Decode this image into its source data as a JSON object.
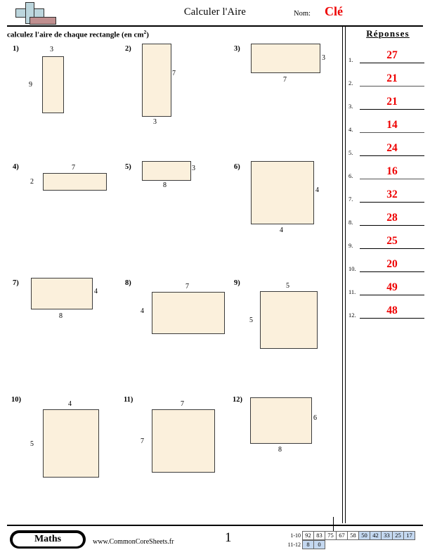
{
  "header": {
    "title": "Calculer l'Aire",
    "name_label": "Nom:",
    "name_value": "Clé",
    "instructions_prefix": "calculez l'aire de chaque rectangle (en cm",
    "instructions_sup": "2",
    "instructions_suffix": ")",
    "logo_icon": "plus-sign-logo",
    "answer_color": "#ee0000"
  },
  "answers": {
    "heading": "Réponses",
    "items": [
      {
        "num": "1.",
        "value": "27"
      },
      {
        "num": "2.",
        "value": "21"
      },
      {
        "num": "3.",
        "value": "21"
      },
      {
        "num": "4.",
        "value": "14"
      },
      {
        "num": "5.",
        "value": "24"
      },
      {
        "num": "6.",
        "value": "16"
      },
      {
        "num": "7.",
        "value": "32"
      },
      {
        "num": "8.",
        "value": "28"
      },
      {
        "num": "9.",
        "value": "25"
      },
      {
        "num": "10.",
        "value": "20"
      },
      {
        "num": "11.",
        "value": "49"
      },
      {
        "num": "12.",
        "value": "48"
      }
    ]
  },
  "problems": [
    {
      "label": "1)",
      "top": "3",
      "left": "9",
      "bottom": "",
      "right": "",
      "area": "27"
    },
    {
      "label": "2)",
      "top": "",
      "left": "",
      "bottom": "3",
      "right": "7",
      "area": "21"
    },
    {
      "label": "3)",
      "top": "",
      "left": "",
      "bottom": "7",
      "right": "3",
      "area": "21"
    },
    {
      "label": "4)",
      "top": "7",
      "left": "2",
      "bottom": "",
      "right": "",
      "area": "14"
    },
    {
      "label": "5)",
      "top": "",
      "left": "",
      "bottom": "8",
      "right": "3",
      "area": "24"
    },
    {
      "label": "6)",
      "top": "",
      "left": "",
      "bottom": "4",
      "right": "4",
      "area": "16"
    },
    {
      "label": "7)",
      "top": "",
      "left": "",
      "bottom": "8",
      "right": "4",
      "area": "32"
    },
    {
      "label": "8)",
      "top": "7",
      "left": "4",
      "bottom": "",
      "right": "",
      "area": "28"
    },
    {
      "label": "9)",
      "top": "5",
      "left": "5",
      "bottom": "",
      "right": "",
      "area": "25"
    },
    {
      "label": "10)",
      "top": "4",
      "left": "5",
      "bottom": "",
      "right": "",
      "area": "20"
    },
    {
      "label": "11)",
      "top": "7",
      "left": "7",
      "bottom": "",
      "right": "",
      "area": "49"
    },
    {
      "label": "12)",
      "top": "",
      "left": "",
      "bottom": "8",
      "right": "6",
      "area": "48"
    }
  ],
  "footer": {
    "brand": "Maths",
    "site": "www.CommonCoreSheets.fr",
    "page": "1",
    "scale": {
      "row1_label": "1-10",
      "row1": [
        "92",
        "83",
        "75",
        "67",
        "58",
        "50",
        "42",
        "33",
        "25",
        "17"
      ],
      "row1_shaded_from": 5,
      "row2_label": "11-12",
      "row2": [
        "8",
        "0"
      ],
      "shade_color": "#c4d8f0"
    }
  }
}
